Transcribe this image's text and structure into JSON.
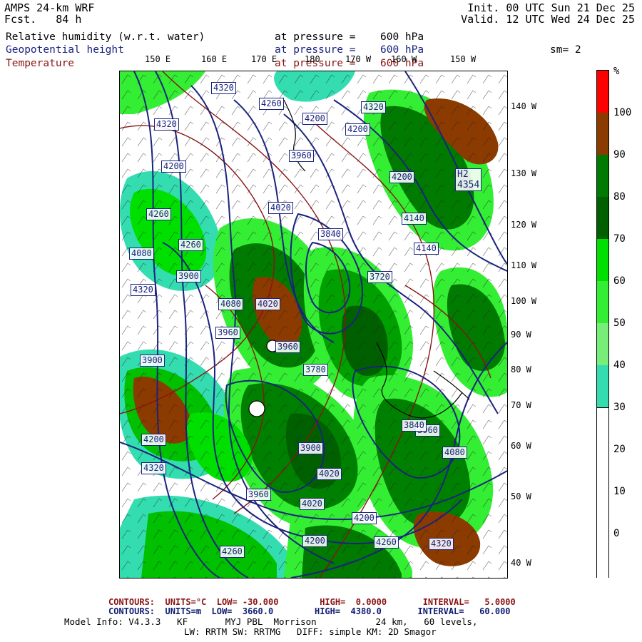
{
  "header": {
    "title": "AMPS 24-km WRF",
    "fcst_label": "Fcst.",
    "fcst_value": "84 h",
    "init": "Init. 00 UTC Sun 21 Dec 25",
    "valid": "Valid. 12 UTC Wed 24 Dec 25"
  },
  "variables": [
    {
      "name": "Relative humidity (w.r.t. water)",
      "pressure_label": "at pressure =",
      "pressure": "600 hPa",
      "color": "#000000"
    },
    {
      "name": "Geopotential height",
      "pressure_label": "at pressure =",
      "pressure": "600 hPa",
      "color": "#1a237e"
    },
    {
      "name": "Temperature",
      "pressure_label": "at pressure =",
      "pressure": "600 hPa",
      "color": "#8a1414"
    }
  ],
  "smoothing": "sm= 2",
  "axis_top": [
    "150 E",
    "160 E",
    "170 E",
    "180",
    "170 W",
    "160 W",
    "150 W"
  ],
  "axis_right": [
    "140 W",
    "130 W",
    "120 W",
    "110 W",
    "100 W",
    "90 W",
    "80 W",
    "70 W",
    "60 W",
    "50 W",
    "40 W"
  ],
  "colorbar": {
    "unit": "%",
    "labels": [
      "100",
      "90",
      "80",
      "70",
      "60",
      "50",
      "40",
      "30",
      "20",
      "10",
      "0"
    ],
    "colors": [
      "#ff0000",
      "#8b3a00",
      "#007a00",
      "#006000",
      "#00e000",
      "#33ee33",
      "#77ee77",
      "#33ddb0",
      "#ffffff",
      "#ffffff",
      "#ffffff",
      "#ffffff"
    ]
  },
  "height_labels": [
    "4320",
    "4260",
    "4200",
    "4320",
    "4200",
    "4320",
    "4200",
    "3960",
    "4020",
    "4200",
    "4260",
    "4080",
    "4140",
    "4260",
    "4320",
    "3900",
    "3840",
    "3720",
    "4080",
    "4020",
    "3960",
    "3780",
    "3960",
    "4200",
    "3900",
    "3960",
    "4140",
    "3840",
    "3900",
    "4020",
    "4080",
    "4020",
    "3960",
    "4200",
    "4260",
    "4320",
    "4260",
    "4200",
    "4320"
  ],
  "high_label": "H2",
  "high_value": "4354",
  "footer": {
    "temp_contours": "CONTOURS:  UNITS=°C  LOW= -30.000        HIGH=  0.0000       INTERVAL=   5.0000",
    "height_contours": "CONTOURS:  UNITS=m  LOW=  3660.0        HIGH=  4380.0       INTERVAL=   60.000",
    "model_info": "Model Info: V4.3.3   KF       MYJ PBL  Morrison           24 km,   60 levels,",
    "model_info2": "LW: RRTM SW: RRTMG   DIFF: simple KM: 2D Smagor"
  }
}
